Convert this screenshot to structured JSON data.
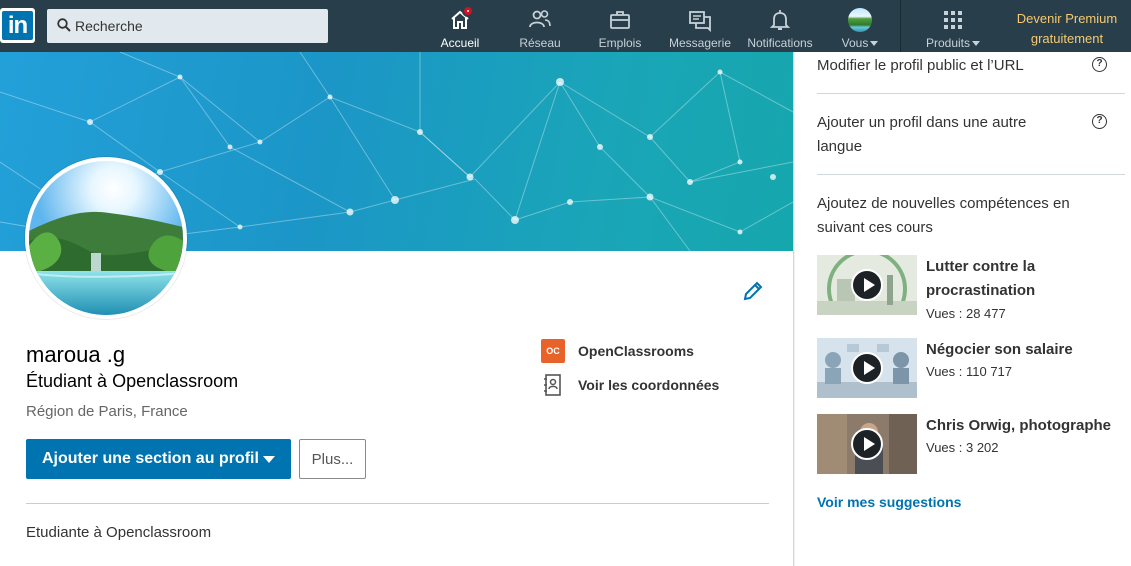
{
  "nav": {
    "logo": "in",
    "search_placeholder": "Recherche",
    "items": [
      {
        "label": "Accueil",
        "icon": "home-icon"
      },
      {
        "label": "Réseau",
        "icon": "network-icon"
      },
      {
        "label": "Emplois",
        "icon": "briefcase-icon"
      },
      {
        "label": "Messagerie",
        "icon": "messaging-icon"
      },
      {
        "label": "Notifications",
        "icon": "bell-icon"
      },
      {
        "label": "Vous",
        "icon": "avatar"
      },
      {
        "label": "Produits",
        "icon": "grid-icon"
      }
    ],
    "premium_line1": "Devenir Premium",
    "premium_line2": "gratuitement",
    "colors": {
      "bar": "#283e4a",
      "premium": "#f5ca72",
      "badge": "#d11124"
    }
  },
  "profile": {
    "name": "maroua .g",
    "headline": "Étudiant à Openclassroom",
    "location": "Région de Paris, France",
    "school_logo": "OC",
    "school": "OpenClassrooms",
    "contact": "Voir les coordonnées",
    "add_section_button": "Ajouter une section au profil",
    "more_button": "Plus...",
    "summary": "Etudiante à Openclassroom",
    "colors": {
      "primary": "#0073b1",
      "school_logo": "#e8632a"
    }
  },
  "rail": {
    "edit_public_profile": "Modifier le profil public et l’URL",
    "add_language_profile_line1": "Ajouter un profil dans une autre",
    "add_language_profile_line2": "langue",
    "help": "?",
    "courses_heading_line1": "Ajoutez de nouvelles compétences en",
    "courses_heading_line2": "suivant ces cours",
    "courses": [
      {
        "title_line1": "Lutter contre la",
        "title_line2": "procrastination",
        "views": "Vues : 28 477"
      },
      {
        "title_line1": "Négocier son salaire",
        "title_line2": "",
        "views": "Vues : 110 717"
      },
      {
        "title_line1": "Chris Orwig, photographe",
        "title_line2": "",
        "views": "Vues : 3 202"
      }
    ],
    "see_suggestions": "Voir mes suggestions"
  }
}
